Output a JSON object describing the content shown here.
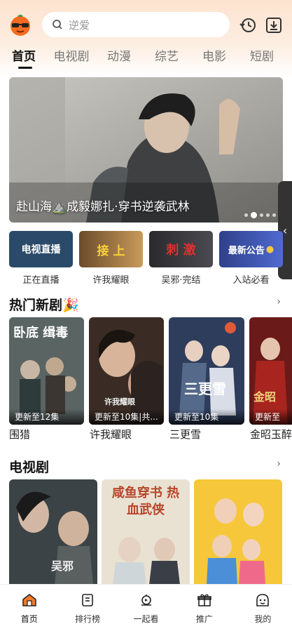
{
  "search": {
    "placeholder": "逆爱"
  },
  "tabs": [
    "首页",
    "电视剧",
    "动漫",
    "综艺",
    "电影",
    "短剧"
  ],
  "banner": {
    "caption": "赴山海⛰️成毅娜扎·穿书逆袭武林"
  },
  "quick_entries": [
    {
      "image_text": "电视直播",
      "label": "正在直播"
    },
    {
      "image_text": "接 上",
      "label": "许我耀眼"
    },
    {
      "image_text": "刺 激",
      "label": "吴邪·完结"
    },
    {
      "image_text": "最新公告",
      "label": "入站必看"
    }
  ],
  "hot_section": {
    "title": "热门新剧🎉",
    "more": "›",
    "items": [
      {
        "badge": "更新至12集",
        "title": "围猎",
        "art_text": "卧底 缉毒"
      },
      {
        "badge": "更新至10集|共...",
        "title": "许我耀眼",
        "art_text": "许我耀眼"
      },
      {
        "badge": "更新至10集",
        "title": "三更雪",
        "art_text": "三更雪"
      },
      {
        "badge": "更新至",
        "title": "金昭玉醉",
        "art_text": "金昭"
      }
    ]
  },
  "tv_section": {
    "title": "电视剧",
    "more": "›",
    "items": [
      {
        "art_text": "吴邪"
      },
      {
        "art_text": "咸鱼穿书 热血武侠"
      },
      {
        "art_text": ""
      }
    ]
  },
  "bottom_nav": [
    {
      "label": "首页",
      "icon": "home-icon"
    },
    {
      "label": "排行榜",
      "icon": "ranking-icon"
    },
    {
      "label": "一起看",
      "icon": "watch-together-icon"
    },
    {
      "label": "推广",
      "icon": "gift-icon"
    },
    {
      "label": "我的",
      "icon": "profile-icon"
    }
  ],
  "colors": {
    "accent": "#f07a2a",
    "active_text": "#111111"
  }
}
